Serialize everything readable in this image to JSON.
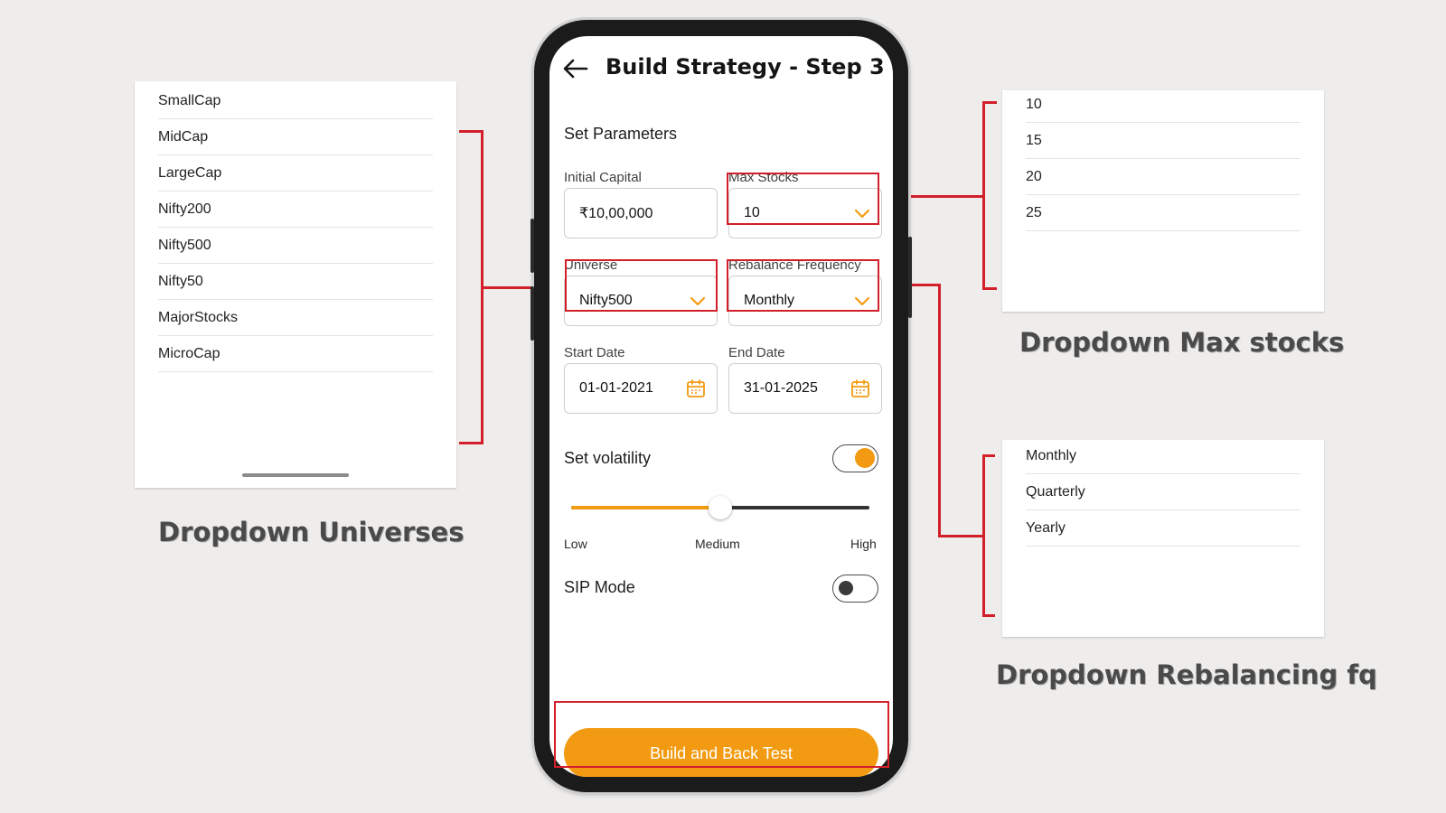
{
  "universe_dropdown": {
    "options": [
      "SmallCap",
      "MidCap",
      "LargeCap",
      "Nifty200",
      "Nifty500",
      "Nifty50",
      "MajorStocks",
      "MicroCap"
    ],
    "caption": "Dropdown Universes"
  },
  "max_stocks_dropdown": {
    "options": [
      "10",
      "15",
      "20",
      "25"
    ],
    "caption": "Dropdown Max stocks"
  },
  "rebalance_dropdown": {
    "options": [
      "Monthly",
      "Quarterly",
      "Yearly"
    ],
    "caption": "Dropdown Rebalancing fq"
  },
  "screen": {
    "title": "Build Strategy - Step 3",
    "section": "Set Parameters",
    "initial_capital": {
      "label": "Initial Capital",
      "value": "₹10,00,000"
    },
    "max_stocks": {
      "label": "Max Stocks",
      "value": "10"
    },
    "universe": {
      "label": "Universe",
      "value": "Nifty500"
    },
    "rebalance": {
      "label": "Rebalance Frequency",
      "value": "Monthly"
    },
    "start_date": {
      "label": "Start Date",
      "value": "01-01-2021"
    },
    "end_date": {
      "label": "End Date",
      "value": "31-01-2025"
    },
    "volatility": {
      "label": "Set volatility",
      "enabled": true,
      "level": 0.5,
      "low": "Low",
      "medium": "Medium",
      "high": "High"
    },
    "sip_mode": {
      "label": "SIP Mode",
      "enabled": false
    },
    "cta": "Build and Back Test"
  },
  "icons": {
    "back": "arrow-left-icon",
    "dropdown": "chevron-down-icon",
    "date": "calendar-icon"
  },
  "colors": {
    "accent": "#f29b12",
    "annotation": "#d21f2a",
    "background": "#efedeb"
  }
}
